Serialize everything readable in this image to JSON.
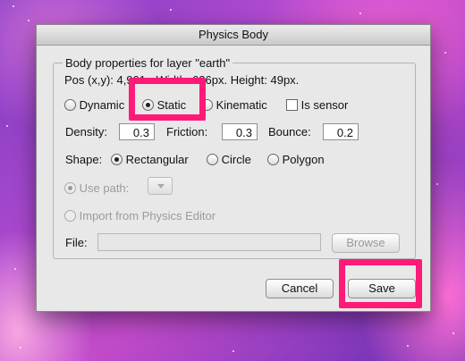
{
  "dialog": {
    "title": "Physics Body",
    "group_title": "Body properties for layer \"earth\"",
    "info_line": "Pos (x,y): 4,901 - Width: 626px. Height: 49px."
  },
  "body_type": {
    "options": [
      {
        "label": "Dynamic",
        "selected": false
      },
      {
        "label": "Static",
        "selected": true
      },
      {
        "label": "Kinematic",
        "selected": false
      }
    ],
    "sensor_label": "Is sensor",
    "sensor_checked": false
  },
  "properties": {
    "density_label": "Density:",
    "density_value": "0.3",
    "friction_label": "Friction:",
    "friction_value": "0.3",
    "bounce_label": "Bounce:",
    "bounce_value": "0.2"
  },
  "shape": {
    "label": "Shape:",
    "options": [
      {
        "label": "Rectangular",
        "selected": true
      },
      {
        "label": "Circle",
        "selected": false
      },
      {
        "label": "Polygon",
        "selected": false
      }
    ]
  },
  "use_path": {
    "label": "Use path:",
    "enabled": false,
    "selected": true
  },
  "import": {
    "label": "Import from Physics Editor",
    "enabled": false
  },
  "file": {
    "label": "File:",
    "value": "",
    "browse_label": "Browse"
  },
  "buttons": {
    "cancel": "Cancel",
    "save": "Save"
  },
  "highlight_color": "#ff1a78"
}
